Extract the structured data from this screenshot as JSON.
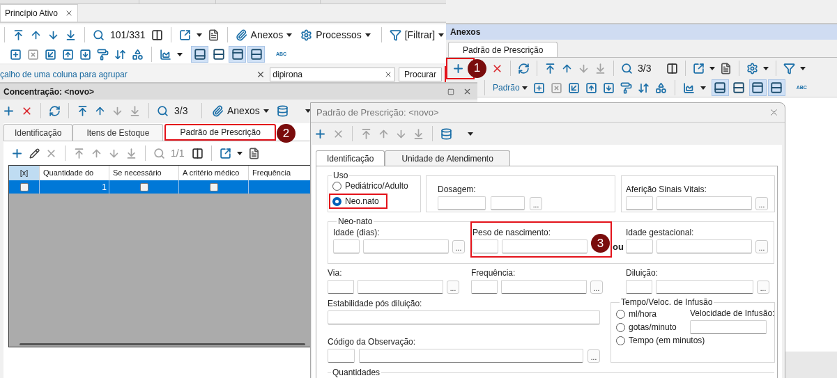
{
  "top_tabs": [
    {
      "label": "Princípio Ativo",
      "selected": true
    }
  ],
  "main_toolbar": {
    "record_counter": "101/331",
    "menus": [
      {
        "label": "Anexos",
        "kind": "attachments"
      },
      {
        "label": "Processos",
        "kind": "processes"
      },
      {
        "label": "[Filtrar]",
        "kind": "filter"
      }
    ],
    "abc_label": "ABC",
    "view_toggles": [
      {
        "selected": true
      },
      {
        "selected": false
      },
      {
        "selected": true
      },
      {
        "selected": true
      }
    ]
  },
  "group_bar": {
    "hint": "çalho de uma coluna para agrupar",
    "search_value": "dipirona",
    "search_button": "Procurar"
  },
  "attachments_panel": {
    "title": "Anexos",
    "tabs": [
      {
        "label": "Padrão de Prescrição",
        "selected": true
      }
    ],
    "new_button": {
      "highlighted": true,
      "callout": "1"
    },
    "record_counter": "3/3",
    "layout_menu": "Padrão",
    "abc_label": "ABC",
    "view_toggles": [
      {
        "selected": true
      },
      {
        "selected": false
      },
      {
        "selected": true
      },
      {
        "selected": true
      }
    ]
  },
  "concentration_panel": {
    "title": "Concentração: <novo>",
    "record_counter": "3/3",
    "attachments_menu": "Anexos",
    "tabs": [
      {
        "label": "Identificação",
        "selected": false,
        "highlighted": false
      },
      {
        "label": "Itens de Estoque",
        "selected": false,
        "highlighted": false
      },
      {
        "label": "Padrão de Prescrição",
        "selected": true,
        "highlighted": true,
        "callout": "2"
      }
    ],
    "sub_counter": "1/1",
    "grid": {
      "columns": [
        "[x]",
        "Quantidade do",
        "Se necessário",
        "A critério médico",
        "Frequência"
      ],
      "rows": [
        {
          "selected": true,
          "marked": false,
          "quantity": "1",
          "if_needed": false,
          "at_discretion": false
        }
      ]
    }
  },
  "dialog": {
    "title": "Padrão de Prescrição: <novo>",
    "tabs": [
      {
        "label": "Identificação",
        "selected": true
      },
      {
        "label": "Unidade de Atendimento",
        "selected": false
      }
    ],
    "usage": {
      "legend": "Uso",
      "options": [
        {
          "label": "Pediátrico/Adulto",
          "selected": false,
          "highlighted": false
        },
        {
          "label": "Neo.nato",
          "selected": true,
          "highlighted": true
        }
      ]
    },
    "dosage": {
      "label": "Dosagem:",
      "button": "..."
    },
    "vitals": {
      "label": "Aferição Sinais Vitais:",
      "button": "..."
    },
    "newborn": {
      "legend": "Neo-nato",
      "fields": [
        {
          "label": "Idade (dias):",
          "button": "..."
        },
        {
          "label": "Peso de nascimento:",
          "highlighted": true,
          "callout": "3",
          "suffix": "ou"
        },
        {
          "label": "Idade gestacional:",
          "button": "..."
        }
      ]
    },
    "lookups": [
      {
        "label": "Via:",
        "button": "..."
      },
      {
        "label": "Frequência:",
        "button": "..."
      },
      {
        "label": "Diluição:",
        "button": "..."
      }
    ],
    "stability": {
      "label": "Estabilidade pós diluição:"
    },
    "observation": {
      "label": "Código da Observação:",
      "button": "..."
    },
    "infusion": {
      "legend": "Tempo/Veloc. de Infusão",
      "options": [
        {
          "label": "ml/hora",
          "selected": false
        },
        {
          "label": "gotas/minuto",
          "selected": false
        },
        {
          "label": "Tempo (em minutos)",
          "selected": false
        }
      ],
      "speed_label": "Velocidade de Infusão:"
    },
    "quantities": {
      "legend": "Quantidades"
    }
  }
}
